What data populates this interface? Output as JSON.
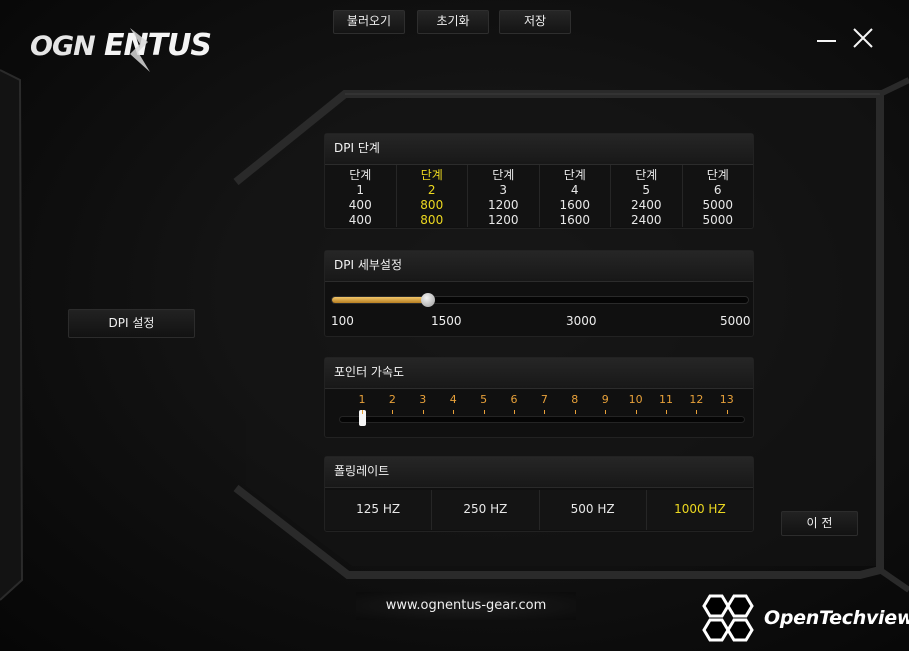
{
  "brand": {
    "logo_text": "OGN ENTUS"
  },
  "toolbar": {
    "load_label": "불러오기",
    "reset_label": "초기화",
    "save_label": "저장"
  },
  "window": {
    "minimize_icon": "minimize-icon",
    "close_icon": "close-icon"
  },
  "sidebar": {
    "dpi_settings_label": "DPI 설정"
  },
  "dpi_stage": {
    "title": "DPI 단계",
    "stage_word": "단계",
    "active_index": 1,
    "stages": [
      {
        "num": "1",
        "x": "400",
        "y": "400"
      },
      {
        "num": "2",
        "x": "800",
        "y": "800"
      },
      {
        "num": "3",
        "x": "1200",
        "y": "1200"
      },
      {
        "num": "4",
        "x": "1600",
        "y": "1600"
      },
      {
        "num": "5",
        "x": "2400",
        "y": "2400"
      },
      {
        "num": "6",
        "x": "5000",
        "y": "5000"
      }
    ]
  },
  "dpi_detail": {
    "title": "DPI 세부설정",
    "min": 100,
    "max": 5000,
    "value_fraction": 0.23,
    "tick_labels": [
      "100",
      "1500",
      "3000",
      "5000"
    ]
  },
  "pointer_accel": {
    "title": "포인터 가속도",
    "levels": [
      "1",
      "2",
      "3",
      "4",
      "5",
      "6",
      "7",
      "8",
      "9",
      "10",
      "11",
      "12",
      "13"
    ],
    "value": 1
  },
  "polling_rate": {
    "title": "폴링레이트",
    "options": [
      "125 HZ",
      "250 HZ",
      "500 HZ",
      "1000 HZ"
    ],
    "active_index": 3
  },
  "nav": {
    "prev_label": "이 전"
  },
  "footer": {
    "url": "www.ognentus-gear.com"
  },
  "watermark": {
    "text": "OpenTechview"
  },
  "colors": {
    "highlight": "#ecd820",
    "accent_orange": "#e8a13a",
    "slider_fill": "#d79e3f"
  }
}
